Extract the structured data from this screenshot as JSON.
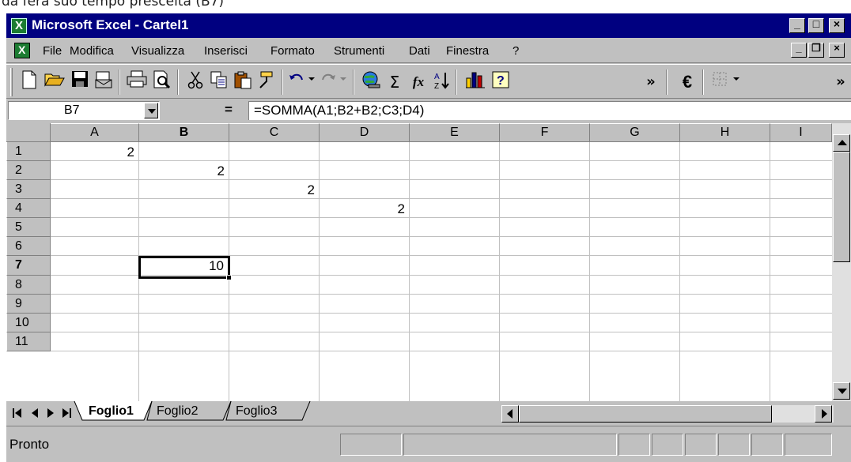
{
  "page_caption": "da ferà suo tempo prescelta (B7)",
  "window": {
    "title": "Microsoft Excel - Cartel1",
    "minimize": "_",
    "maximize": "□",
    "close": "×"
  },
  "menu": {
    "items": [
      "File",
      "Modifica",
      "Visualizza",
      "Inserisci",
      "Formato",
      "Strumenti",
      "Dati",
      "Finestra",
      "?"
    ],
    "doc_minimize": "_",
    "doc_restore": "❐",
    "doc_close": "×"
  },
  "toolbar": {
    "icons": [
      "new-icon",
      "open-icon",
      "save-icon",
      "email-icon",
      "print-icon",
      "print-preview-icon",
      "cut-icon",
      "copy-icon",
      "paste-icon",
      "format-painter-icon",
      "undo-icon",
      "redo-icon",
      "hyperlink-icon",
      "autosum-icon",
      "function-icon",
      "sort-ascending-icon",
      "chart-wizard-icon",
      "help-icon",
      "more-icon",
      "euro-icon",
      "borders-icon"
    ],
    "autosum": "Σ",
    "function": "fx",
    "euro": "€",
    "more": "»"
  },
  "formula_bar": {
    "name_box": "B7",
    "equals": "=",
    "formula": "=SOMMA(A1;B2+B2;C3;D4)"
  },
  "grid": {
    "columns": [
      "A",
      "B",
      "C",
      "D",
      "E",
      "F",
      "G",
      "H",
      "I"
    ],
    "active_column": "B",
    "rows": [
      "1",
      "2",
      "3",
      "4",
      "5",
      "6",
      "7",
      "8",
      "9",
      "10",
      "11"
    ],
    "active_row": "7",
    "cells": {
      "A1": "2",
      "B2": "2",
      "C3": "2",
      "D4": "2",
      "B7": "10"
    },
    "selected_cell": "B7"
  },
  "sheets": {
    "tabs": [
      "Foglio1",
      "Foglio2",
      "Foglio3"
    ],
    "active": "Foglio1"
  },
  "status": {
    "text": "Pronto"
  }
}
